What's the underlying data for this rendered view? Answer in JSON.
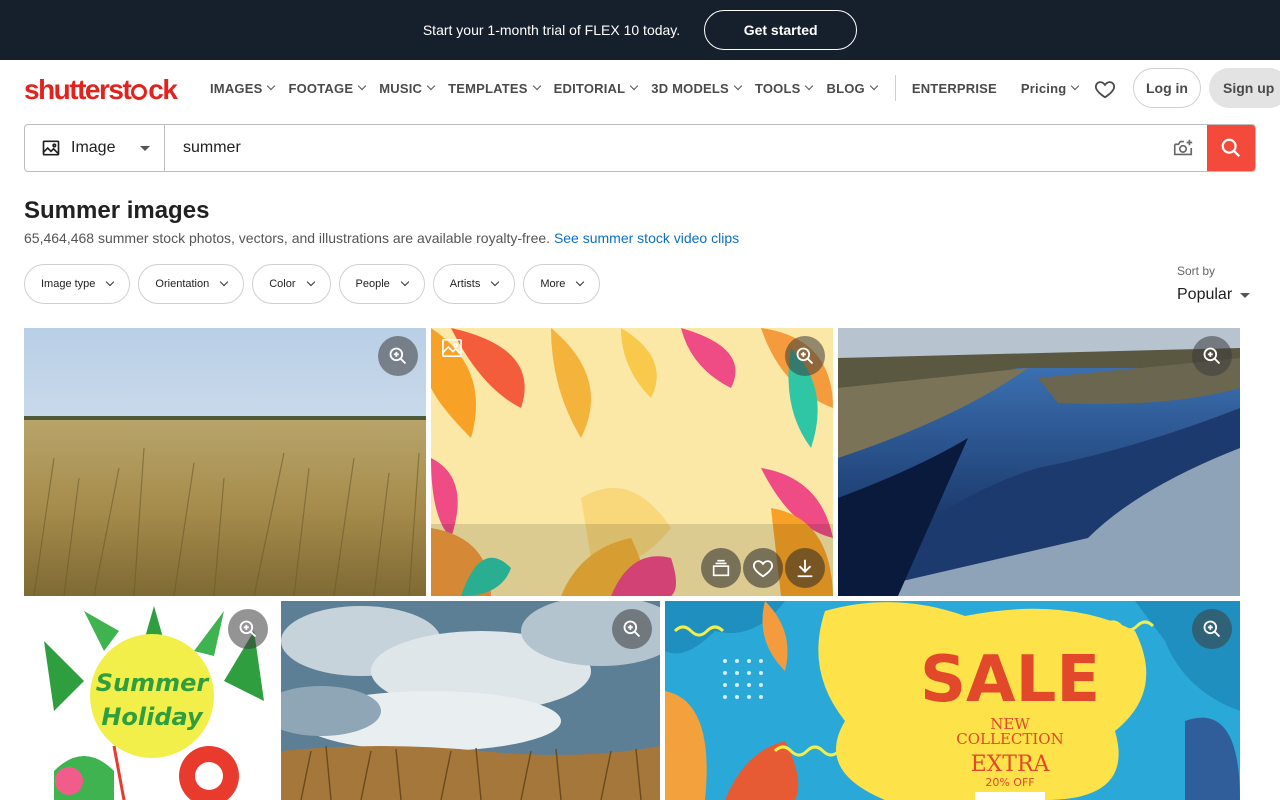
{
  "promo": {
    "text": "Start your 1-month trial of FLEX 10 today.",
    "cta": "Get started"
  },
  "nav": {
    "logo": "shutterstock",
    "items": [
      "IMAGES",
      "FOOTAGE",
      "MUSIC",
      "TEMPLATES",
      "EDITORIAL",
      "3D MODELS",
      "TOOLS",
      "BLOG"
    ],
    "enterprise": "ENTERPRISE",
    "pricing": "Pricing",
    "login": "Log in",
    "signup": "Sign up"
  },
  "search": {
    "type": "Image",
    "query": "summer"
  },
  "results": {
    "title": "Summer images",
    "summary": "65,464,468 summer stock photos, vectors, and illustrations are available royalty-free.",
    "video_link": "See summer stock video clips"
  },
  "filters": [
    "Image type",
    "Orientation",
    "Color",
    "People",
    "Artists",
    "More"
  ],
  "sort": {
    "label": "Sort by",
    "value": "Popular"
  },
  "colors": {
    "brand": "#e1221d",
    "search_button": "#f44a3c",
    "link": "#0c6fc4",
    "promo_bg": "#16202c"
  }
}
